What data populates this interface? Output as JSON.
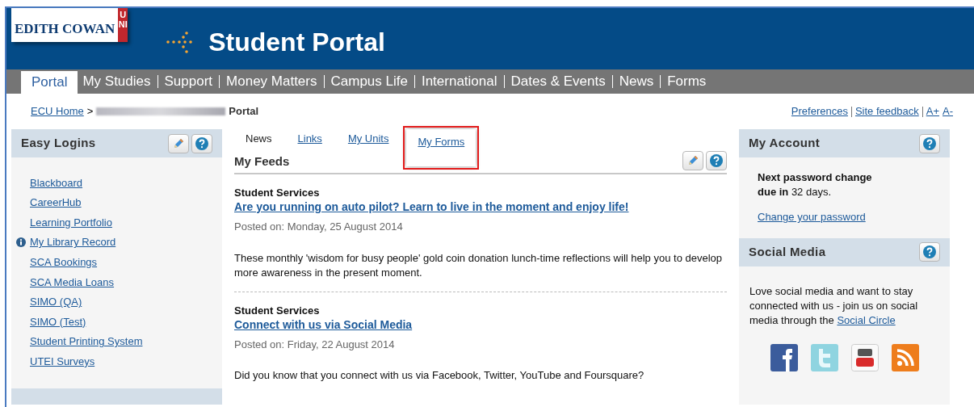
{
  "header": {
    "logo_text": "EDITH COWAN",
    "logo_tag": "UNI",
    "title": "Student Portal"
  },
  "nav": [
    {
      "label": "Portal",
      "selected": true
    },
    {
      "label": "My Studies",
      "selected": false
    },
    {
      "label": "Support",
      "selected": false
    },
    {
      "label": "Money Matters",
      "selected": false
    },
    {
      "label": "Campus Life",
      "selected": false
    },
    {
      "label": "International",
      "selected": false
    },
    {
      "label": "Dates & Events",
      "selected": false
    },
    {
      "label": "News",
      "selected": false
    },
    {
      "label": "Forms",
      "selected": false
    }
  ],
  "breadcrumb": {
    "home": "ECU Home",
    "separator": ">",
    "current": "Portal"
  },
  "utility_links": [
    "Preferences",
    "Site feedback",
    "A+",
    "A-"
  ],
  "easy_logins": {
    "title": "Easy Logins",
    "items": [
      {
        "label": "Blackboard",
        "info": false
      },
      {
        "label": "CareerHub",
        "info": false
      },
      {
        "label": "Learning Portfolio",
        "info": false
      },
      {
        "label": "My Library Record",
        "info": true
      },
      {
        "label": "SCA Bookings",
        "info": false
      },
      {
        "label": "SCA Media Loans",
        "info": false
      },
      {
        "label": "SIMO (QA)",
        "info": false
      },
      {
        "label": "SIMO (Test)",
        "info": false
      },
      {
        "label": "Student Printing System",
        "info": false
      },
      {
        "label": "UTEI Surveys",
        "info": false
      }
    ]
  },
  "tabs": [
    {
      "label": "News",
      "selected": true,
      "highlighted": false
    },
    {
      "label": "Links",
      "selected": false,
      "highlighted": false
    },
    {
      "label": "My Units",
      "selected": false,
      "highlighted": false
    },
    {
      "label": "My Forms",
      "selected": false,
      "highlighted": true
    }
  ],
  "feeds": {
    "title": "My Feeds",
    "items": [
      {
        "source": "Student Services",
        "headline": "Are you running on auto pilot? Learn to live in the moment and enjoy life!",
        "posted": "Posted on: Monday, 25 August 2014",
        "body": "These monthly 'wisdom for busy people' gold coin donation lunch-time reflections will help you to develop more awareness in the present moment."
      },
      {
        "source": "Student Services",
        "headline": "Connect with us via Social Media",
        "posted": "Posted on: Friday, 22 August 2014",
        "body": "Did you know that you connect with us via Facebook, Twitter, YouTube and Foursquare?"
      }
    ]
  },
  "my_account": {
    "title": "My Account",
    "notice": "**Next password change due in** 32 days.",
    "link": "Change your password"
  },
  "social_media": {
    "title": "Social Media",
    "text": "Love social media and want to stay connected with us - join us on social media through the",
    "link": "Social Circle",
    "icons": [
      {
        "kind": "facebook"
      },
      {
        "kind": "twitter"
      },
      {
        "kind": "youtube"
      },
      {
        "kind": "rss"
      }
    ]
  }
}
